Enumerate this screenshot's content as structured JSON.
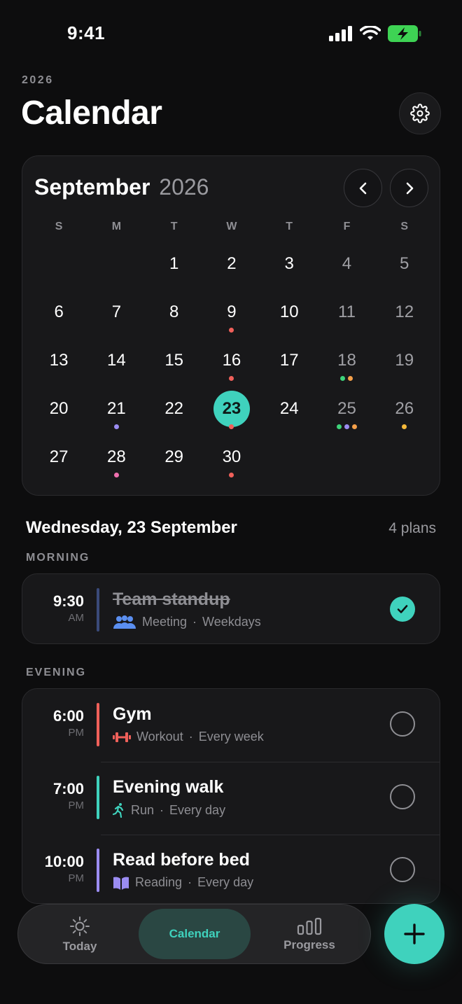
{
  "status": {
    "time": "9:41"
  },
  "header": {
    "year": "2026",
    "title": "Calendar"
  },
  "calendar": {
    "month": "September",
    "year": "2026",
    "weekdays": [
      "S",
      "M",
      "T",
      "W",
      "T",
      "F",
      "S"
    ],
    "leading_blanks": 2,
    "days": [
      {
        "d": "1",
        "dots": []
      },
      {
        "d": "2",
        "dots": []
      },
      {
        "d": "3",
        "dots": []
      },
      {
        "d": "4",
        "dots": []
      },
      {
        "d": "5",
        "dots": []
      },
      {
        "d": "6",
        "dots": []
      },
      {
        "d": "7",
        "dots": []
      },
      {
        "d": "8",
        "dots": []
      },
      {
        "d": "9",
        "dots": [
          "#f0605a"
        ]
      },
      {
        "d": "10",
        "dots": []
      },
      {
        "d": "11",
        "dots": []
      },
      {
        "d": "12",
        "dots": []
      },
      {
        "d": "13",
        "dots": []
      },
      {
        "d": "14",
        "dots": []
      },
      {
        "d": "15",
        "dots": []
      },
      {
        "d": "16",
        "dots": [
          "#f0605a"
        ]
      },
      {
        "d": "17",
        "dots": []
      },
      {
        "d": "18",
        "dots": [
          "#3ed37a",
          "#f5a04a"
        ]
      },
      {
        "d": "19",
        "dots": []
      },
      {
        "d": "20",
        "dots": []
      },
      {
        "d": "21",
        "dots": [
          "#9b8cf2"
        ]
      },
      {
        "d": "22",
        "dots": []
      },
      {
        "d": "23",
        "dots": [
          "#f0605a"
        ],
        "selected": true
      },
      {
        "d": "24",
        "dots": []
      },
      {
        "d": "25",
        "dots": [
          "#3ed37a",
          "#9b8cf2",
          "#f5a04a"
        ]
      },
      {
        "d": "26",
        "dots": [
          "#f5b93a"
        ]
      },
      {
        "d": "27",
        "dots": []
      },
      {
        "d": "28",
        "dots": [
          "#ef6fae"
        ]
      },
      {
        "d": "29",
        "dots": []
      },
      {
        "d": "30",
        "dots": [
          "#f0605a"
        ]
      }
    ]
  },
  "day_view": {
    "heading": "Wednesday, 23 September",
    "count": "4 plans",
    "morning_label": "MORNING",
    "evening_label": "EVENING",
    "morning": [
      {
        "time": "9:30",
        "ampm": "AM",
        "title": "Team standup",
        "category": "Meeting",
        "repeat": "Weekdays",
        "done": true,
        "accent": "#3a4a7a",
        "icon": "people-icon",
        "icon_color": "#5b8ff0"
      }
    ],
    "evening": [
      {
        "time": "6:00",
        "ampm": "PM",
        "title": "Gym",
        "category": "Workout",
        "repeat": "Every week",
        "done": false,
        "accent": "#f0605a",
        "icon": "dumbbell-icon",
        "icon_color": "#f0605a"
      },
      {
        "time": "7:00",
        "ampm": "PM",
        "title": "Evening walk",
        "category": "Run",
        "repeat": "Every day",
        "done": false,
        "accent": "#3fd2bd",
        "icon": "runner-icon",
        "icon_color": "#3fd2bd"
      },
      {
        "time": "10:00",
        "ampm": "PM",
        "title": "Read before bed",
        "category": "Reading",
        "repeat": "Every day",
        "done": false,
        "accent": "#9b8cf2",
        "icon": "book-icon",
        "icon_color": "#9b8cf2"
      }
    ]
  },
  "tabs": {
    "today": "Today",
    "calendar": "Calendar",
    "progress": "Progress"
  },
  "colors": {
    "accent": "#3fd2bd",
    "background": "#0d0d0e",
    "card": "#18181a"
  }
}
